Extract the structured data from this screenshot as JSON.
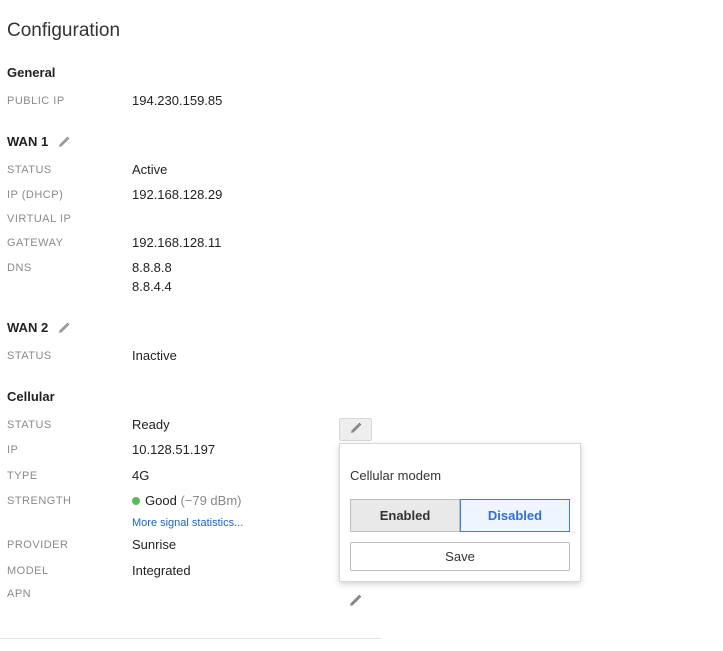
{
  "page_title": "Configuration",
  "general": {
    "title": "General",
    "rows": [
      {
        "label": "PUBLIC IP",
        "value": "194.230.159.85"
      }
    ]
  },
  "wan1": {
    "title": "WAN 1",
    "rows": [
      {
        "label": "STATUS",
        "value": "Active"
      },
      {
        "label": "IP (DHCP)",
        "value": "192.168.128.29"
      },
      {
        "label": "VIRTUAL IP",
        "value": ""
      },
      {
        "label": "GATEWAY",
        "value": "192.168.128.11"
      },
      {
        "label": "DNS",
        "values": [
          "8.8.8.8",
          "8.8.4.4"
        ]
      }
    ]
  },
  "wan2": {
    "title": "WAN 2",
    "rows": [
      {
        "label": "STATUS",
        "value": "Inactive"
      }
    ]
  },
  "cellular": {
    "title": "Cellular",
    "rows": [
      {
        "label": "STATUS",
        "value": "Ready"
      },
      {
        "label": "IP",
        "value": "10.128.51.197"
      },
      {
        "label": "TYPE",
        "value": "4G"
      },
      {
        "label": "STRENGTH",
        "quality": "Good",
        "dbm": "(−79 dBm)",
        "link": "More signal statistics..."
      },
      {
        "label": "PROVIDER",
        "value": "Sunrise"
      },
      {
        "label": "MODEL",
        "value": "Integrated"
      },
      {
        "label": "APN",
        "value": ""
      }
    ],
    "signal_color": "#5cb85c"
  },
  "popover": {
    "title": "Cellular modem",
    "options": [
      "Enabled",
      "Disabled"
    ],
    "selected": "Disabled",
    "save_label": "Save"
  },
  "colors": {
    "accent": "#3b7ddd",
    "link": "#1a63c9",
    "label": "#8a8a8a"
  },
  "icons": {
    "edit": "pencil-icon"
  }
}
